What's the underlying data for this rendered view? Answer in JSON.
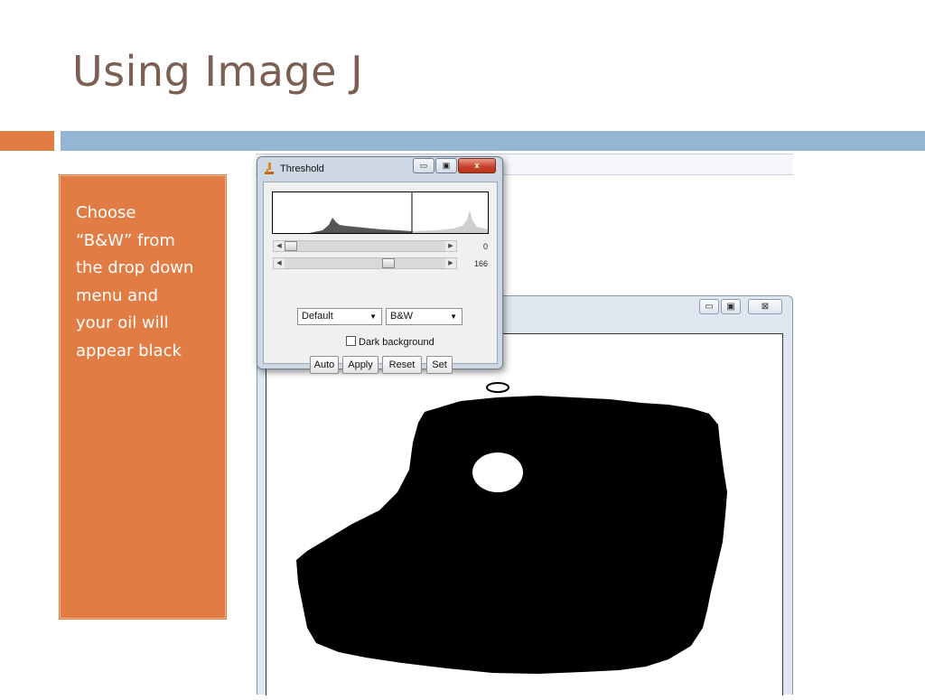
{
  "slide": {
    "title": "Using Image J",
    "callout_lines": [
      "Choose",
      "“B&W” from",
      "the drop down",
      "menu and",
      "your oil will",
      "appear black"
    ]
  },
  "image_window": {
    "minimize_glyph": "▭",
    "maximize_glyph": "▣",
    "close_glyph": "⊠"
  },
  "threshold": {
    "title": "Threshold",
    "minimize_glyph": "▭",
    "maximize_glyph": "▣",
    "close_glyph": "x",
    "slider_min_value": "0",
    "slider_max_value": "166",
    "slider_min_fraction": 0.0,
    "slider_max_fraction": 0.65,
    "method_select": "Default",
    "mode_select": "B&W",
    "dark_background_label": "Dark background",
    "dark_background_checked": false,
    "buttons": {
      "auto": "Auto",
      "apply": "Apply",
      "reset": "Reset",
      "set": "Set"
    }
  },
  "colors": {
    "title": "#7a5f52",
    "accent_orange": "#e07c44",
    "accent_blue": "#94b5d3"
  },
  "icons": {
    "threshold_icon": "microscope-icon",
    "slider_left": "arrow-left-icon",
    "slider_right": "arrow-right-icon",
    "dropdown": "chevron-down-icon"
  }
}
